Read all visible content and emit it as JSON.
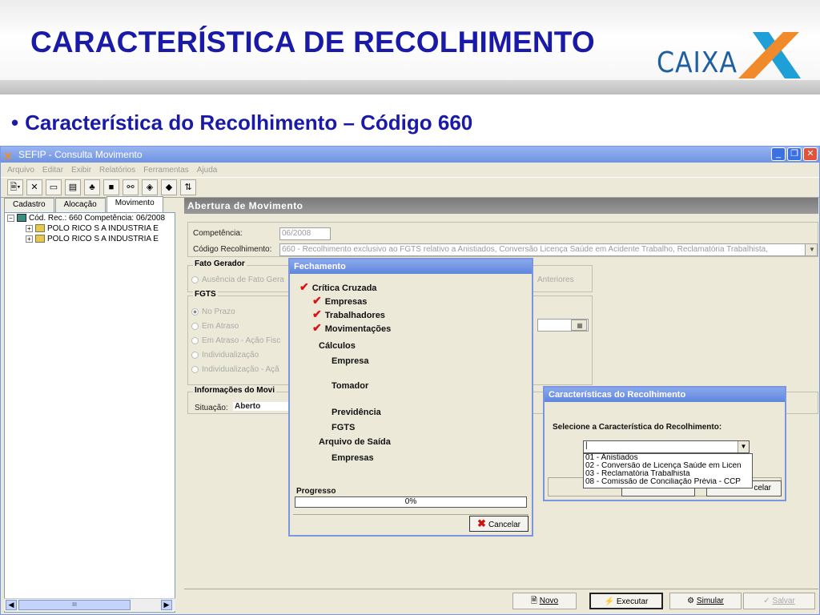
{
  "slide": {
    "title": "CARACTERÍSTICA DE RECOLHIMENTO",
    "logo_text": "CAIXA",
    "subtitle": "Característica do Recolhimento – Código 660",
    "bullet": "•"
  },
  "window": {
    "title": "SEFIP - Consulta Movimento",
    "menu": [
      "Arquivo",
      "Editar",
      "Exibir",
      "Relatórios",
      "Ferramentas",
      "Ajuda"
    ],
    "minimize": "_",
    "restore": "❐",
    "close": "✕"
  },
  "tabs": [
    "Cadastro",
    "Alocação",
    "Movimento"
  ],
  "tree": {
    "root": "Cód. Rec.: 660 Competência: 06/2008",
    "children": [
      "POLO RICO S A INDUSTRIA E",
      "POLO RICO S A INDUSTRIA E"
    ],
    "scroll_thumb": "III"
  },
  "abertura": {
    "header": "Abertura de Movimento",
    "competencia_label": "Competência:",
    "competencia_value": "06/2008",
    "codigo_label": "Código Recolhimento:",
    "codigo_value": "660 - Recolhimento exclusivo ao FGTS relativo a Anistiados, Conversão Licença Saúde em Acidente Trabalho, Reclamatória Trabalhista,"
  },
  "fato_gerador": {
    "legend": "Fato Gerador",
    "option": "Ausência de Fato Gera",
    "option_right": "Anteriores"
  },
  "fgts": {
    "legend": "FGTS",
    "options": [
      "No Prazo",
      "Em Atraso",
      "Em Atraso - Ação Fisc",
      "Individualização",
      "Individualização - Açã"
    ]
  },
  "informacoes": {
    "legend": "Informações do Movi",
    "situacao_label": "Situação:",
    "situacao_value": "Aberto"
  },
  "bottom_buttons": [
    "Novo",
    "Executar",
    "Simular",
    "Salvar"
  ],
  "fechamento": {
    "title": "Fechamento",
    "checked": [
      "Crítica Cruzada",
      "Empresas",
      "Trabalhadores",
      "Movimentações"
    ],
    "items": [
      "Cálculos",
      "Empresa",
      "Tomador",
      "Previdência",
      "FGTS",
      "Arquivo de Saída",
      "Empresas"
    ],
    "progress_label": "Progresso",
    "progress_value": "0%",
    "progress_fraction": 0,
    "cancel_label": "Cancelar"
  },
  "caracteristicas": {
    "title": "Características do Recolhimento",
    "prompt": "Selecione a Característica do Recolhimento:",
    "selected": "",
    "options": [
      "01 - Anistiados",
      "02 - Conversão de Licença Saúde em Licen",
      "03 - Reclamatória Trabalhista",
      "08 - Comissão de Conciliação Prévia - CCP"
    ],
    "cancel_fragment": "celar"
  },
  "colors": {
    "title_blue": "#1a1aa8",
    "logo_orange": "#f08a2a",
    "logo_blue": "#1f5fa0",
    "xp_title": "#6f93e3"
  }
}
